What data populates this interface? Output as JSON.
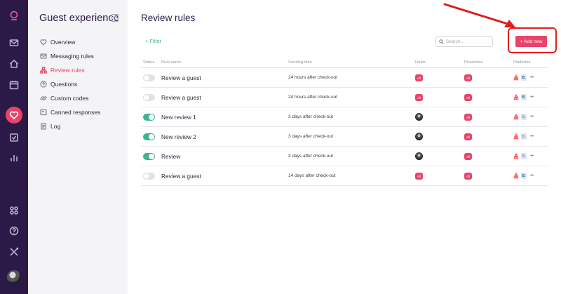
{
  "rail": {
    "icons": [
      "logo-icon",
      "mail-icon",
      "home-icon",
      "calendar-icon",
      "heart-icon",
      "checklist-icon",
      "bar-chart-icon",
      "apps-icon",
      "help-icon",
      "integrations-icon",
      "avatar"
    ]
  },
  "sidebar": {
    "title": "Guest experience",
    "items": [
      {
        "label": "Overview",
        "icon": "heart-outline-icon"
      },
      {
        "label": "Messaging rules",
        "icon": "envelope-icon"
      },
      {
        "label": "Review rules",
        "icon": "sitemap-icon",
        "active": true
      },
      {
        "label": "Questions",
        "icon": "question-circle-icon"
      },
      {
        "label": "Custom codes",
        "icon": "link-icon"
      },
      {
        "label": "Canned responses",
        "icon": "reply-icon"
      },
      {
        "label": "Log",
        "icon": "document-icon"
      }
    ]
  },
  "main": {
    "title": "Review rules",
    "filter_label": "+ Filter",
    "search_placeholder": "Search...",
    "add_button": "+ Add new",
    "columns": {
      "status": "Status",
      "rule_name": "Rule name",
      "sending_time": "Sending time",
      "hosts": "Hosts",
      "properties": "Properties",
      "platforms": "Platforms"
    },
    "all_badge": "All",
    "booking_glyph": "B.",
    "more_glyph": "•••",
    "rows": [
      {
        "enabled": false,
        "name": "Review a guest",
        "time": "24 hours after check-out",
        "hosts": "all"
      },
      {
        "enabled": false,
        "name": "Review a guest",
        "time": "24 hours after check-out",
        "hosts": "all"
      },
      {
        "enabled": true,
        "name": "New review 1",
        "time": "3 days after check-out",
        "hosts": "avatar"
      },
      {
        "enabled": true,
        "name": "New review 2",
        "time": "3 days after check-out",
        "hosts": "avatar"
      },
      {
        "enabled": true,
        "name": "Review",
        "time": "3 days after check-out",
        "hosts": "avatar"
      },
      {
        "enabled": false,
        "name": "Review a guest",
        "time": "14 days after check-out",
        "hosts": "all"
      }
    ]
  },
  "colors": {
    "rail_bg": "#2b1a47",
    "accent": "#e8446b",
    "toggle_on": "#3bb58f",
    "annotation": "#e31c1c"
  }
}
